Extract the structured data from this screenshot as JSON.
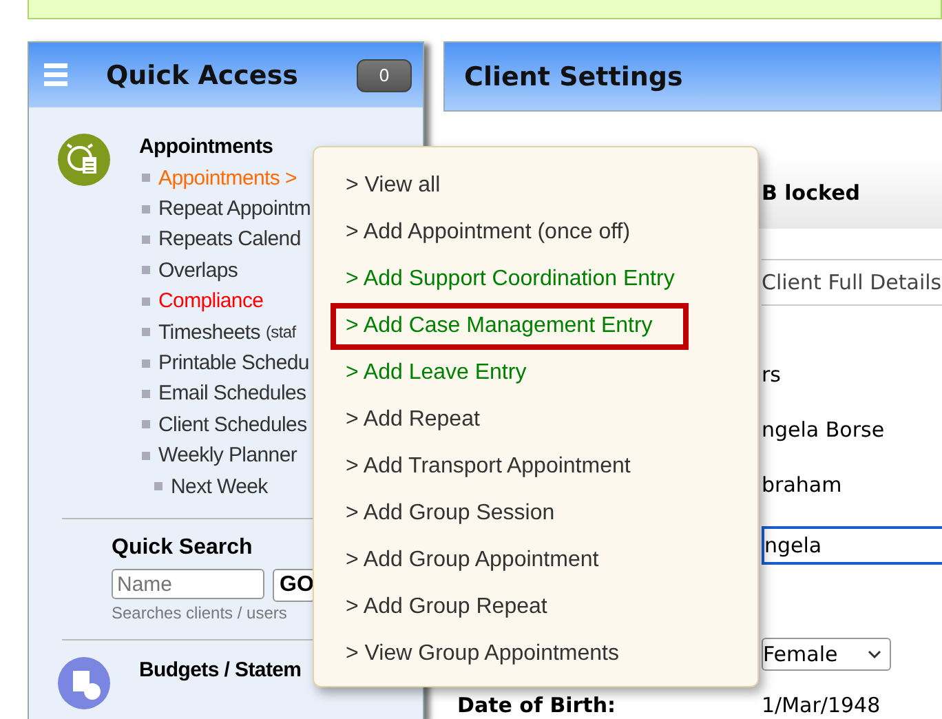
{
  "quick_access": {
    "title": "Quick Access",
    "badge": "0",
    "sections": [
      {
        "title": "Appointments",
        "items": [
          {
            "label": "Appointments >",
            "color": "#ff6a00"
          },
          {
            "label": "Repeat Appointm",
            "color": "#333333"
          },
          {
            "label": "Repeats Calend",
            "color": "#333333"
          },
          {
            "label": "Overlaps",
            "color": "#333333"
          },
          {
            "label": "Compliance",
            "color": "#ff0000"
          },
          {
            "label": "Timesheets",
            "note": "(staf",
            "color": "#333333"
          },
          {
            "label": "Printable Schedu",
            "color": "#333333"
          },
          {
            "label": "Email Schedules",
            "color": "#333333"
          },
          {
            "label": "Client Schedules",
            "color": "#333333"
          },
          {
            "label": "Weekly Planner",
            "color": "#333333",
            "children": [
              {
                "label": "Next Week",
                "color": "#333333"
              }
            ]
          }
        ]
      }
    ],
    "quick_search": {
      "title": "Quick Search",
      "placeholder": "Name",
      "button": "GO",
      "hint": "Searches clients / users"
    },
    "next_section": {
      "title": "Budgets / Statem"
    }
  },
  "client_settings": {
    "title": "Client Settings",
    "lock_notice": "B locked",
    "details_tab": "Client Full Details",
    "fields": [
      {
        "kind": "text",
        "value": "rs"
      },
      {
        "kind": "text",
        "value": "ngela Borse"
      },
      {
        "kind": "text",
        "value": "braham"
      },
      {
        "kind": "input",
        "value": "ngela"
      },
      {
        "kind": "select",
        "value": "Female"
      },
      {
        "kind": "labeled",
        "label": "Date of Birth:",
        "value": "1/Mar/1948"
      }
    ]
  },
  "popup_menu": {
    "items": [
      {
        "label": "> View all",
        "color": "#333333",
        "highlighted": false
      },
      {
        "label": "> Add Appointment (once off)",
        "color": "#333333",
        "highlighted": false
      },
      {
        "label": "> Add Support Coordination Entry",
        "color": "#008000",
        "highlighted": false
      },
      {
        "label": "> Add Case Management Entry",
        "color": "#008000",
        "highlighted": true
      },
      {
        "label": "> Add Leave Entry",
        "color": "#008000",
        "highlighted": false
      },
      {
        "label": "> Add Repeat",
        "color": "#333333",
        "highlighted": false
      },
      {
        "label": "> Add Transport Appointment",
        "color": "#333333",
        "highlighted": false
      },
      {
        "label": "> Add Group Session",
        "color": "#333333",
        "highlighted": false
      },
      {
        "label": "> Add Group Appointment",
        "color": "#333333",
        "highlighted": false
      },
      {
        "label": "> Add Group Repeat",
        "color": "#333333",
        "highlighted": false
      },
      {
        "label": "> View Group Appointments",
        "color": "#333333",
        "highlighted": false
      }
    ]
  }
}
